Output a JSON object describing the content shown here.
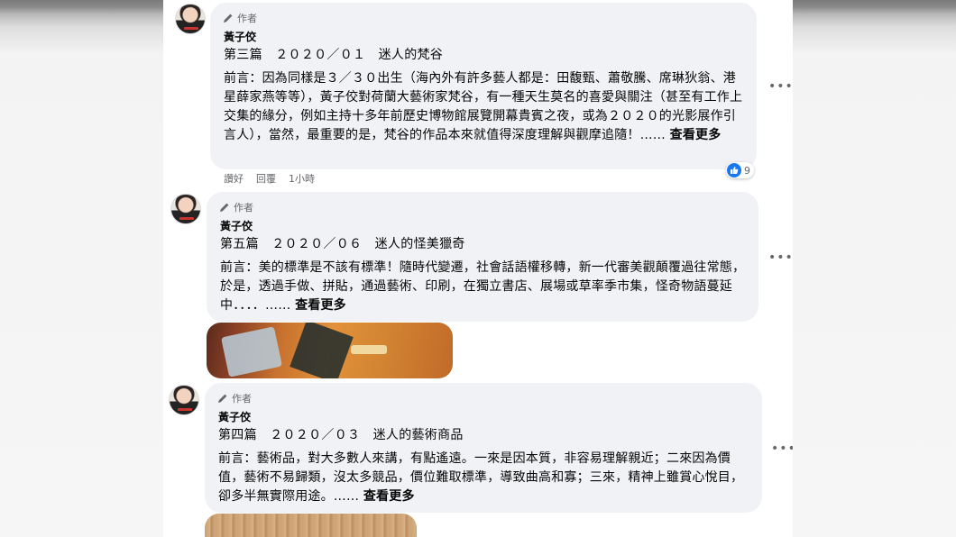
{
  "comments": [
    {
      "author_badge": "作者",
      "name": "黃子佼",
      "heading": "第三篇　２０２０／０１　迷人的梵谷",
      "body": "前言：因為同樣是３／３０出生（海內外有許多藝人都是：田馥甄、蕭敬騰、席琳狄翁、港星薛家燕等等），黃子佼對荷蘭大藝術家梵谷，有一種天生莫名的喜愛與關注（甚至有工作上交集的緣分，例如主持十多年前歷史博物館展覽開幕貴賓之夜，或為２０２０的光影展作引言人），當然，最重要的是，梵谷的作品本來就值得深度理解與觀摩追隨！……",
      "see_more": "查看更多",
      "more_options": "•••",
      "actions": {
        "like": "讚好",
        "reply": "回覆",
        "time": "1小時"
      },
      "reaction_count": "9"
    },
    {
      "author_badge": "作者",
      "name": "黃子佼",
      "heading": "第五篇　２０２０／０６　迷人的怪美獵奇",
      "body": "前言：美的標準是不該有標準！隨時代變遷，社會話語權移轉，新一代審美觀顛覆過往常態，於是，透過手做、拼貼，通過藝術、印刷，在獨立書店、展場或草率季市集，怪奇物語蔓延中．．．．……",
      "see_more": "查看更多",
      "more_options": "•••"
    },
    {
      "author_badge": "作者",
      "name": "黃子佼",
      "heading": "第四篇　２０２０／０３　迷人的藝術商品",
      "body": "前言：藝術品，對大多數人來講，有點遙遠。一來是因本質，非容易理解親近；二來因為價值，藝術不易歸類，沒太多競品，價位難取標準，導致曲高和寡；三來，精神上雖賞心悅目，卻多半無實際用途。……",
      "see_more": "查看更多",
      "more_options": "•••"
    }
  ],
  "colors": {
    "bubble": "#f0f2f5",
    "like_blue": "#1877f2",
    "secondary_text": "#65676b"
  }
}
